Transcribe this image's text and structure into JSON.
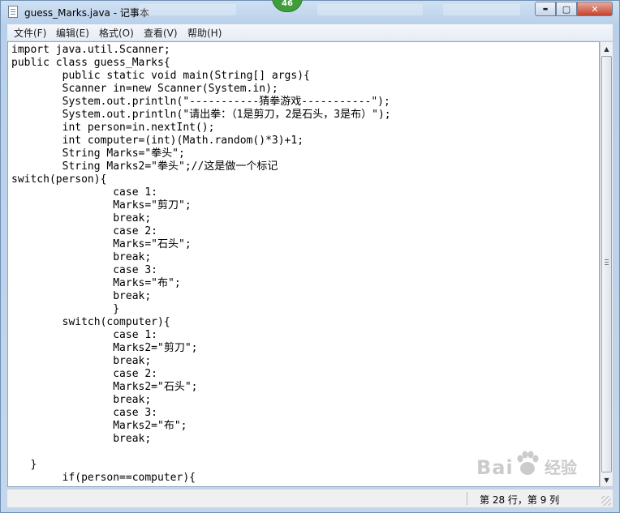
{
  "window": {
    "title": "guess_Marks.java - 记事本",
    "badge": "46",
    "buttons": {
      "minimize": "▬",
      "maximize": "▢",
      "close": "✕"
    }
  },
  "menu": {
    "items": [
      "文件(F)",
      "编辑(E)",
      "格式(O)",
      "查看(V)",
      "帮助(H)"
    ]
  },
  "editor": {
    "lines": [
      "import java.util.Scanner;",
      "public class guess_Marks{",
      "        public static void main(String[] args){",
      "        Scanner in=new Scanner(System.in);",
      "        System.out.println(\"-----------猜拳游戏-----------\");",
      "        System.out.println(\"请出拳：（1是剪刀，2是石头，3是布）\");",
      "        int person=in.nextInt();",
      "        int computer=(int)(Math.random()*3)+1;",
      "        String Marks=\"拳头\";",
      "        String Marks2=\"拳头\";//这是做一个标记",
      "switch(person){",
      "                case 1:",
      "                Marks=\"剪刀\";",
      "                break;",
      "                case 2:",
      "                Marks=\"石头\";",
      "                break;",
      "                case 3:",
      "                Marks=\"布\";",
      "                break;",
      "                }",
      "        switch(computer){",
      "                case 1:",
      "                Marks2=\"剪刀\";",
      "                break;",
      "                case 2:",
      "                Marks2=\"石头\";",
      "                break;",
      "                case 3:",
      "                Marks2=\"布\";",
      "                break;",
      "",
      "   }",
      "        if(person==computer){"
    ]
  },
  "status": {
    "position": "第 28 行，第 9 列"
  },
  "watermark": {
    "brand": "Bai",
    "brand2": "经验"
  },
  "colors": {
    "badge": "#3f9e3b",
    "close_button": "#c5432f"
  }
}
